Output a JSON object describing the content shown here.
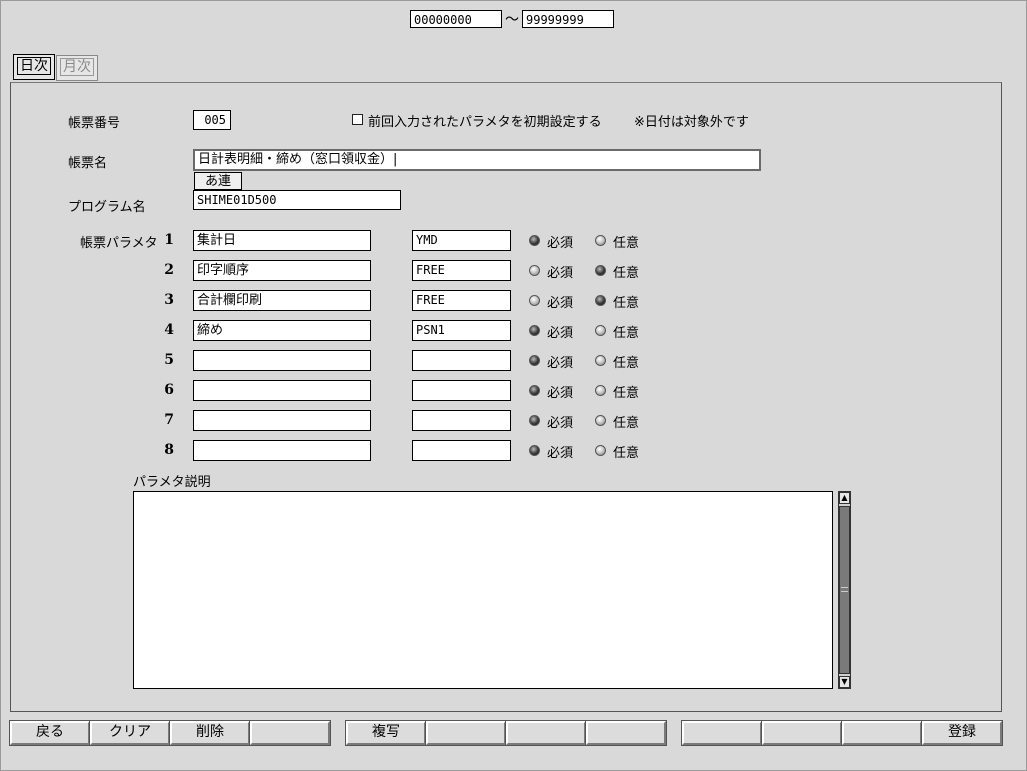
{
  "range": {
    "from": "00000000",
    "tilde": "～",
    "to": "99999999"
  },
  "tabs": [
    {
      "label": "日次"
    },
    {
      "label": "月次"
    }
  ],
  "form": {
    "report_no_label": "帳票番号",
    "report_no_value": "005",
    "init_param_label": "前回入力されたパラメタを初期設定する",
    "date_note": "※日付は対象外です",
    "report_name_label": "帳票名",
    "report_name_value": "日計表明細・締め（窓口領収金）",
    "ime_label": "あ連",
    "program_label": "プログラム名",
    "program_value": "SHIME01D500",
    "param_label": "帳票パラメタ",
    "required_label": "必須",
    "optional_label": "任意",
    "desc_label": "パラメタ説明",
    "desc_value": ""
  },
  "params": [
    {
      "no": "1",
      "name": "集計日",
      "type": "YMD",
      "required": true
    },
    {
      "no": "2",
      "name": "印字順序",
      "type": "FREE",
      "required": false
    },
    {
      "no": "3",
      "name": "合計欄印刷",
      "type": "FREE",
      "required": false
    },
    {
      "no": "4",
      "name": "締め",
      "type": "PSN1",
      "required": true
    },
    {
      "no": "5",
      "name": "",
      "type": "",
      "required": true
    },
    {
      "no": "6",
      "name": "",
      "type": "",
      "required": true
    },
    {
      "no": "7",
      "name": "",
      "type": "",
      "required": true
    },
    {
      "no": "8",
      "name": "",
      "type": "",
      "required": true
    }
  ],
  "buttons": [
    "戻る",
    "クリア",
    "削除",
    "",
    "複写",
    "",
    "",
    "",
    "",
    "",
    "",
    "登録"
  ]
}
